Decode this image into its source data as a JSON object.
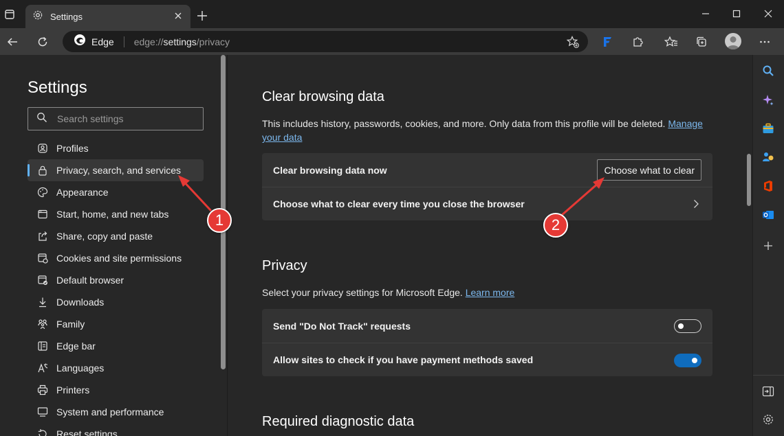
{
  "window": {
    "tab_title": "Settings"
  },
  "toolbar": {
    "edge_label": "Edge",
    "url_prefix": "edge://",
    "url_main": "settings",
    "url_suffix": "/privacy"
  },
  "sidebar": {
    "title": "Settings",
    "search_placeholder": "Search settings",
    "items": [
      {
        "label": "Profiles",
        "icon": "profile-icon"
      },
      {
        "label": "Privacy, search, and services",
        "icon": "lock-icon",
        "active": true
      },
      {
        "label": "Appearance",
        "icon": "palette-icon"
      },
      {
        "label": "Start, home, and new tabs",
        "icon": "home-tabs-icon"
      },
      {
        "label": "Share, copy and paste",
        "icon": "share-icon"
      },
      {
        "label": "Cookies and site permissions",
        "icon": "cookie-icon"
      },
      {
        "label": "Default browser",
        "icon": "browser-icon"
      },
      {
        "label": "Downloads",
        "icon": "download-icon"
      },
      {
        "label": "Family",
        "icon": "family-icon"
      },
      {
        "label": "Edge bar",
        "icon": "edge-bar-icon"
      },
      {
        "label": "Languages",
        "icon": "language-icon"
      },
      {
        "label": "Printers",
        "icon": "printer-icon"
      },
      {
        "label": "System and performance",
        "icon": "system-icon"
      },
      {
        "label": "Reset settings",
        "icon": "reset-icon"
      }
    ]
  },
  "clear_data": {
    "title": "Clear browsing data",
    "desc": "This includes history, passwords, cookies, and more. Only data from this profile will be deleted.",
    "manage_link_1": "Manage",
    "manage_link_2": "your data",
    "row1_label": "Clear browsing data now",
    "choose_button": "Choose what to clear",
    "row2_label": "Choose what to clear every time you close the browser"
  },
  "privacy": {
    "title": "Privacy",
    "desc": "Select your privacy settings for Microsoft Edge.",
    "learn_more": "Learn more",
    "row1_label": "Send \"Do Not Track\" requests",
    "row1_on": false,
    "row2_label": "Allow sites to check if you have payment methods saved",
    "row2_on": true
  },
  "diagnostic": {
    "title": "Required diagnostic data"
  },
  "annotations": {
    "badge1": "1",
    "badge2": "2"
  },
  "colors": {
    "accent": "#60b1f5",
    "link": "#7cb8ee",
    "toggle_on": "#0f6cbd",
    "annotation": "#e53935"
  }
}
